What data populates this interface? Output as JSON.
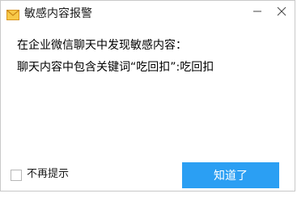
{
  "window": {
    "title": "敏感内容报警"
  },
  "message": {
    "line1": "在企业微信聊天中发现敏感内容：",
    "line2": "聊天内容中包含关键词“吃回扣”:吃回扣"
  },
  "footer": {
    "checkbox_label": "不再提示",
    "checkbox_checked": false,
    "confirm_label": "知道了"
  },
  "colors": {
    "accent": "#2b9ff3",
    "icon_envelope": "#f2b632"
  },
  "icons": {
    "title": "envelope-icon",
    "minimize": "minimize-icon",
    "close": "close-icon"
  }
}
